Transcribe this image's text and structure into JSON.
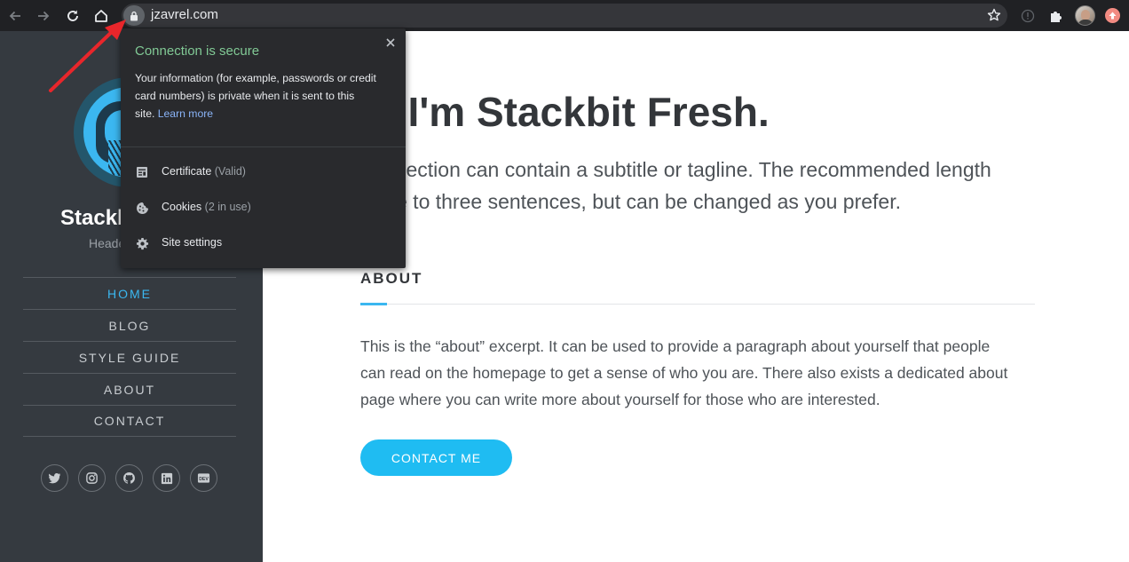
{
  "browser": {
    "url": "jzavrel.com",
    "accent_secure": "#81c995",
    "link_color": "#8ab4f8"
  },
  "security_popup": {
    "title": "Connection is secure",
    "body_line1": "Your information (for example, passwords or credit",
    "body_line2": "card numbers) is private when it is sent to this",
    "body_line3": "site.",
    "learn_more": "Learn more",
    "rows": [
      {
        "label": "Certificate",
        "sub": "(Valid)",
        "icon": "certificate-icon"
      },
      {
        "label": "Cookies",
        "sub": "(2 in use)",
        "icon": "cookie-icon"
      },
      {
        "label": "Site settings",
        "sub": "",
        "icon": "gear-icon"
      }
    ]
  },
  "sidebar": {
    "title": "Stackb",
    "tagline": "Heade",
    "nav": [
      {
        "label": "HOME",
        "active": true
      },
      {
        "label": "BLOG"
      },
      {
        "label": "STYLE GUIDE"
      },
      {
        "label": "ABOUT"
      },
      {
        "label": "CONTACT"
      }
    ],
    "socials": [
      "twitter-icon",
      "instagram-icon",
      "github-icon",
      "linkedin-icon",
      "dev-icon"
    ],
    "dev_label": "DEV",
    "accent": "#3bb7f0"
  },
  "hero": {
    "title": ", I'm Stackbit Fresh.",
    "subtitle_line1": "section can contain a subtitle or tagline. The recommended length",
    "subtitle_line2": "e to three sentences, but can be changed as you prefer."
  },
  "about": {
    "heading": "ABOUT",
    "line1": "This is the “about” excerpt. It can be used to provide a paragraph about yourself that people",
    "line2": "can read on the homepage to get a sense of who you are. There also exists a dedicated about",
    "line3": "page where you can write more about yourself for those who are interested.",
    "button": "CONTACT ME",
    "button_color": "#1fbcf2"
  }
}
